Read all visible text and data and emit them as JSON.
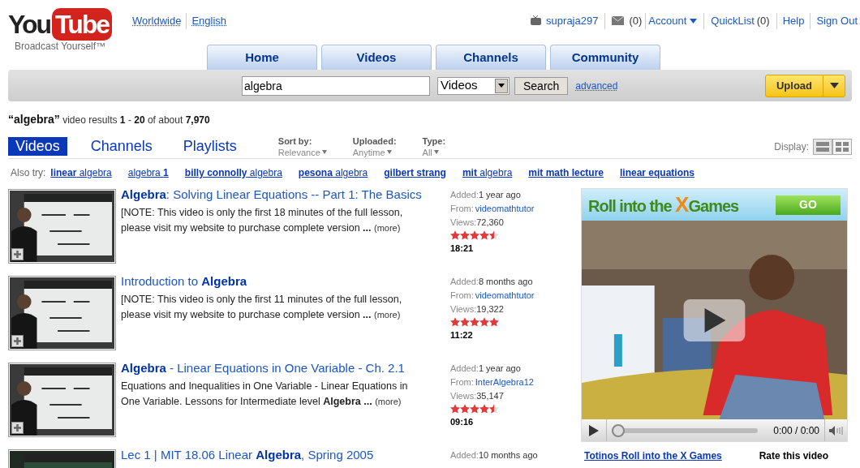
{
  "logo": {
    "left": "You",
    "right": "Tube",
    "slogan": "Broadcast Yourself™"
  },
  "locale_links": [
    "Worldwide",
    "English"
  ],
  "user_bar": {
    "username": "supraja297",
    "inbox_count": "(0)",
    "account": "Account",
    "quicklist": "QuickList",
    "quicklist_count": "(0)",
    "help": "Help",
    "sign_out": "Sign Out"
  },
  "tabs": [
    {
      "label": "Home",
      "selected": false
    },
    {
      "label": "Videos",
      "selected": false
    },
    {
      "label": "Channels",
      "selected": false
    },
    {
      "label": "Community",
      "selected": false
    }
  ],
  "search": {
    "value": "algebra",
    "category": "Videos",
    "button": "Search",
    "advanced": "advanced",
    "upload": "Upload"
  },
  "summary": "**“algebra”** video results **1** - **20** of about **7,970**",
  "result_tabs": [
    {
      "label": "Videos",
      "selected": true
    },
    {
      "label": "Channels",
      "selected": false
    },
    {
      "label": "Playlists",
      "selected": false
    }
  ],
  "filters": [
    {
      "label": "Sort by:",
      "value": "Relevance"
    },
    {
      "label": "Uploaded:",
      "value": "Anytime"
    },
    {
      "label": "Type:",
      "value": "All"
    }
  ],
  "display": {
    "label": "Display:",
    "views": [
      {
        "kind": "list",
        "selected": true
      },
      {
        "kind": "grid",
        "selected": false
      }
    ]
  },
  "also_try": {
    "label": "Also try:",
    "links": [
      "**linear** algebra",
      "algebra **1**",
      "**billy connolly** algebra",
      "**pesona** algebra",
      "**gilbert strang**",
      "**mit** algebra",
      "**mit math lecture**",
      "**linear equations**"
    ]
  },
  "results": [
    {
      "added_label": "Added:",
      "from_label": "From:",
      "views_label": "Views:",
      "title": "**Algebra**: Solving Linear Equations -- Part 1: The Basics",
      "description": "[NOTE: This video is only the first 18 minutes of the full lesson, please visit my website to purchase complete version **...**",
      "more": "(more)",
      "added": "1 year ago",
      "from": "videomathtutor",
      "views": "72,360",
      "stars": 4.5,
      "duration": "18:21"
    },
    {
      "added_label": "Added:",
      "from_label": "From:",
      "views_label": "Views:",
      "title": "Introduction to **Algebra**",
      "description": "[NOTE: This video is only the first 11 minutes of the full lesson, please visit my website to purchase complete version **...**",
      "more": "(more)",
      "added": "8 months ago",
      "from": "videomathtutor",
      "views": "19,322",
      "stars": 5,
      "duration": "11:22"
    },
    {
      "added_label": "Added:",
      "from_label": "From:",
      "views_label": "Views:",
      "title": "**Algebra** - Linear Equations in One Variable - Ch. 2.1",
      "description": "Equations and Inequalities in One Variable - Linear Equations in One Variable. Lessons for Intermediate level **Algebra ...**",
      "more": "(more)",
      "added": "1 year ago",
      "from": "InterAlgebra12",
      "views": "35,147",
      "stars": 4.5,
      "duration": "09:16"
    },
    {
      "added_label": "Added:",
      "title": "Lec 1 | MIT 18.06 Linear **Algebra**, Spring 2005",
      "added": "10 months ago"
    }
  ],
  "ad": {
    "banner": "Roll into the",
    "banner_x": "X",
    "banner_rest": "Games",
    "go": "GO",
    "time": "0:00 / 0:00",
    "level": 0,
    "link": "Totinos Roll into the X Games",
    "rate": "Rate this video"
  }
}
